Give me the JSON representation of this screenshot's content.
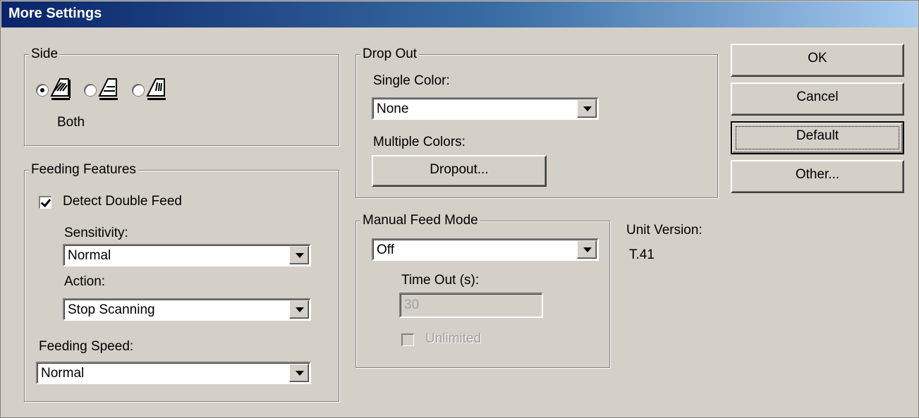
{
  "window": {
    "title": "More Settings"
  },
  "side": {
    "label": "Side",
    "options": [
      "both-sides-icon",
      "front-side-icon",
      "back-side-icon"
    ],
    "selected_caption": "Both"
  },
  "feeding": {
    "label": "Feeding Features",
    "detect_double_feed": {
      "label": "Detect Double Feed",
      "checked": true
    },
    "sensitivity": {
      "label": "Sensitivity:",
      "value": "Normal"
    },
    "action": {
      "label": "Action:",
      "value": "Stop Scanning"
    },
    "speed": {
      "label": "Feeding Speed:",
      "value": "Normal"
    }
  },
  "dropout": {
    "label": "Drop Out",
    "single_color": {
      "label": "Single Color:",
      "value": "None"
    },
    "multiple_colors": {
      "label": "Multiple Colors:",
      "button": "Dropout..."
    }
  },
  "manual_feed": {
    "label": "Manual Feed Mode",
    "value": "Off",
    "timeout": {
      "label": "Time Out (s):",
      "value": "30"
    },
    "unlimited": {
      "label": "Unlimited",
      "checked": false
    }
  },
  "unit_version": {
    "label": "Unit Version:",
    "value": "T.41"
  },
  "buttons": {
    "ok": "OK",
    "cancel": "Cancel",
    "default": "Default",
    "other": "Other..."
  }
}
